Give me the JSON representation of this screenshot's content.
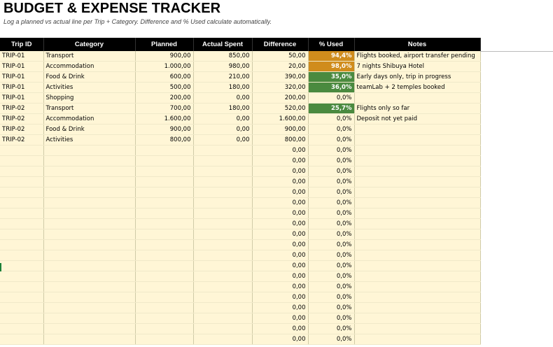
{
  "title": "BUDGET & EXPENSE TRACKER",
  "subtitle": "Log a planned vs actual line per Trip + Category. Difference and % Used calculate automatically.",
  "columns": [
    "Trip ID",
    "Category",
    "Planned",
    "Actual Spent",
    "Difference",
    "% Used",
    "Notes"
  ],
  "rows": [
    {
      "trip": "TRIP-01",
      "category": "Transport",
      "planned": "900,00",
      "actual": "850,00",
      "diff": "50,00",
      "pct": "94,4%",
      "notes": "Flights booked, airport transfer pending",
      "status": "high"
    },
    {
      "trip": "TRIP-01",
      "category": "Accommodation",
      "planned": "1.000,00",
      "actual": "980,00",
      "diff": "20,00",
      "pct": "98,0%",
      "notes": "7 nights Shibuya Hotel",
      "status": "high"
    },
    {
      "trip": "TRIP-01",
      "category": "Food & Drink",
      "planned": "600,00",
      "actual": "210,00",
      "diff": "390,00",
      "pct": "35,0%",
      "notes": "Early days only, trip in progress",
      "status": "ok"
    },
    {
      "trip": "TRIP-01",
      "category": "Activities",
      "planned": "500,00",
      "actual": "180,00",
      "diff": "320,00",
      "pct": "36,0%",
      "notes": "teamLab + 2 temples booked",
      "status": "ok"
    },
    {
      "trip": "TRIP-01",
      "category": "Shopping",
      "planned": "200,00",
      "actual": "0,00",
      "diff": "200,00",
      "pct": "0,0%",
      "notes": "",
      "status": "none"
    },
    {
      "trip": "TRIP-02",
      "category": "Transport",
      "planned": "700,00",
      "actual": "180,00",
      "diff": "520,00",
      "pct": "25,7%",
      "notes": "Flights only so far",
      "status": "ok"
    },
    {
      "trip": "TRIP-02",
      "category": "Accommodation",
      "planned": "1.600,00",
      "actual": "0,00",
      "diff": "1.600,00",
      "pct": "0,0%",
      "notes": "Deposit not yet paid",
      "status": "none"
    },
    {
      "trip": "TRIP-02",
      "category": "Food & Drink",
      "planned": "900,00",
      "actual": "0,00",
      "diff": "900,00",
      "pct": "0,0%",
      "notes": "",
      "status": "none"
    },
    {
      "trip": "TRIP-02",
      "category": "Activities",
      "planned": "800,00",
      "actual": "0,00",
      "diff": "800,00",
      "pct": "0,0%",
      "notes": "",
      "status": "none"
    }
  ],
  "empty_row": {
    "diff": "0,00",
    "pct": "0,0%"
  },
  "empty_row_count": 19,
  "colors": {
    "high": "#d08c1c",
    "ok": "#4a8a3f",
    "cell_bg": "#fff6d6",
    "header_bg": "#000000"
  }
}
